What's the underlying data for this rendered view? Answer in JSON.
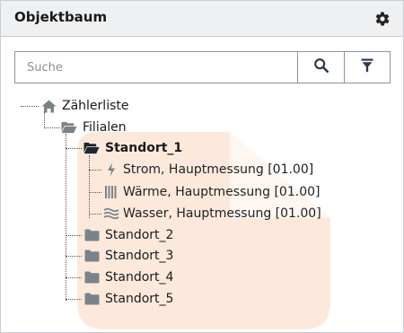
{
  "header": {
    "title": "Objektbaum",
    "settings_icon": "gear-icon"
  },
  "search": {
    "placeholder": "Suche",
    "search_icon": "search-icon",
    "filter_icon": "filter-icon"
  },
  "tree": {
    "root": {
      "label": "Zählerliste",
      "icon": "home-icon"
    },
    "group": {
      "label": "Filialen",
      "icon": "folder-open-icon"
    },
    "expanded": {
      "label": "Standort_1",
      "icon": "folder-open-icon"
    },
    "leaves": [
      {
        "label": "Strom, Hauptmessung [01.00]",
        "icon": "bolt-icon"
      },
      {
        "label": "Wärme, Hauptmessung [01.00]",
        "icon": "radiator-icon"
      },
      {
        "label": "Wasser, Hauptmessung [01.00]",
        "icon": "water-icon"
      }
    ],
    "collapsed": [
      {
        "label": "Standort_2",
        "icon": "folder-icon"
      },
      {
        "label": "Standort_3",
        "icon": "folder-icon"
      },
      {
        "label": "Standort_4",
        "icon": "folder-icon"
      },
      {
        "label": "Standort_5",
        "icon": "folder-icon"
      }
    ]
  },
  "colors": {
    "watermark": "#fde9dc",
    "icon": "#7b8388",
    "header_bg": "#eef0f2"
  }
}
